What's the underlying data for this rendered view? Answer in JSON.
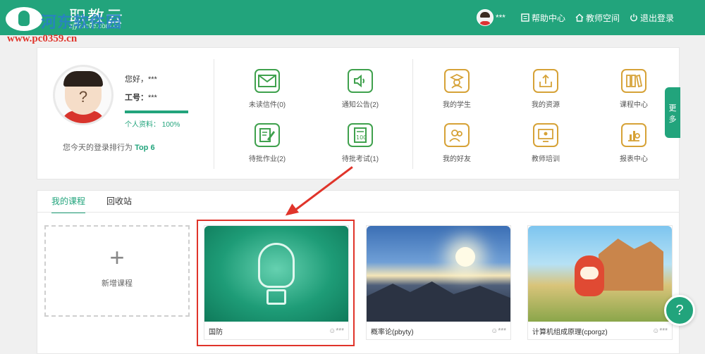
{
  "brand": {
    "name": "职教云",
    "url_text": "zjy2.icve.com.cn",
    "watermark_text": "河东软件园",
    "watermark_url": "www.pc0359.cn"
  },
  "nav": {
    "user_name": "***",
    "help": "帮助中心",
    "teacher_space": "教师空间",
    "logout": "退出登录"
  },
  "profile": {
    "greeting": "您好，***",
    "emp_label": "工号：",
    "emp_value": "***",
    "completion_label": "个人资料：",
    "completion_value": "100%",
    "completion_fraction": 1.0,
    "rank_text": "您今天的登录排行为",
    "rank_value": "Top 6"
  },
  "tiles_left": [
    {
      "label": "未读信件(0)",
      "icon": "mail-icon"
    },
    {
      "label": "通知公告(2)",
      "icon": "speaker-icon"
    },
    {
      "label": "待批作业(2)",
      "icon": "edit-doc-icon"
    },
    {
      "label": "待批考试(1)",
      "icon": "exam-icon"
    }
  ],
  "tiles_right": [
    {
      "label": "我的学生",
      "icon": "student-icon"
    },
    {
      "label": "我的资源",
      "icon": "upload-icon"
    },
    {
      "label": "课程中心",
      "icon": "books-icon"
    },
    {
      "label": "我的好友",
      "icon": "friends-icon"
    },
    {
      "label": "教师培训",
      "icon": "training-icon"
    },
    {
      "label": "报表中心",
      "icon": "chart-icon"
    }
  ],
  "more_label": "更多",
  "tabs": {
    "my_courses": "我的课程",
    "recycle": "回收站"
  },
  "add_course": {
    "label": "新增课程"
  },
  "courses": [
    {
      "title": "国防",
      "owner": "***"
    },
    {
      "title": "概率论(pbyty)",
      "owner": "***"
    },
    {
      "title": "计算机组成原理(cporgz)",
      "owner": "***"
    }
  ],
  "colors": {
    "primary": "#22a47c",
    "highlight": "#e0342a",
    "icon_green": "#3fa14d",
    "icon_gold": "#d6a237"
  }
}
